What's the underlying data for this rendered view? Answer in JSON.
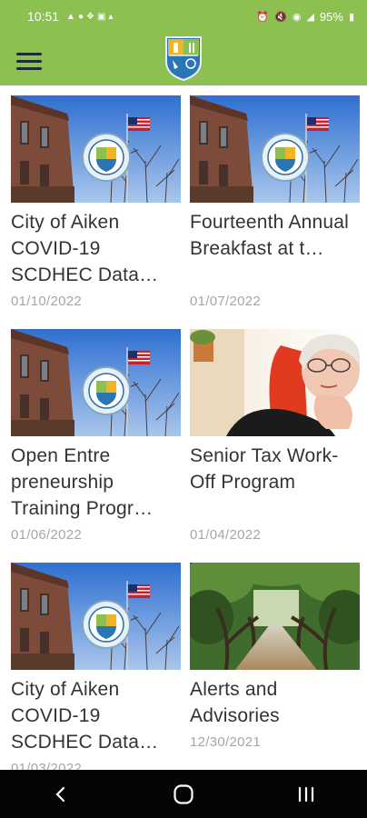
{
  "status_bar": {
    "time": "10:51",
    "battery": "95%"
  },
  "articles": [
    {
      "title": "City of Aiken COVID-19 SCDHEC Data…",
      "date": "01/10/2022",
      "image": "city-hall-flag"
    },
    {
      "title": "Fourteenth Annual Breakfast at t…",
      "date": "01/07/2022",
      "image": "city-hall-flag"
    },
    {
      "title": "Open Entre preneurship Training Progr…",
      "date": "01/06/2022",
      "image": "city-hall-flag"
    },
    {
      "title": "Senior Tax Work-Off Program",
      "date": "01/04/2022",
      "image": "senior-woman"
    },
    {
      "title": "City of Aiken COVID-19 SCDHEC Data…",
      "date": "01/03/2022",
      "image": "city-hall-flag"
    },
    {
      "title": "Alerts and Advisories",
      "date": "12/30/2021",
      "image": "oak-avenue"
    }
  ],
  "colors": {
    "header": "#8cc152",
    "nav_bar": "#050505",
    "title_text": "#333333",
    "date_text": "#a6a6a6"
  }
}
